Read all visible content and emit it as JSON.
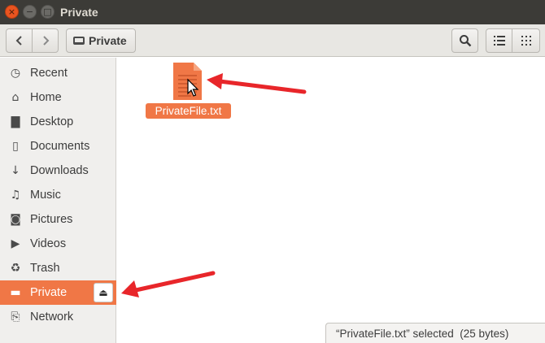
{
  "window": {
    "title": "Private",
    "close_glyph": "×",
    "minimize_glyph": "−",
    "maximize_glyph": "□"
  },
  "toolbar": {
    "back_glyph": "‹",
    "forward_glyph": "›",
    "breadcrumb_label": "Private",
    "breadcrumb_icon": "drive-icon",
    "search_icon": "search-icon",
    "list_view_icon": "list-view-icon",
    "grid_view_icon": "grid-view-icon"
  },
  "sidebar": {
    "items": [
      {
        "label": "Recent",
        "icon": "recent-icon",
        "glyph": "◷"
      },
      {
        "label": "Home",
        "icon": "home-icon",
        "glyph": "⌂"
      },
      {
        "label": "Desktop",
        "icon": "desktop-icon",
        "glyph": "▇"
      },
      {
        "label": "Documents",
        "icon": "documents-icon",
        "glyph": "▯"
      },
      {
        "label": "Downloads",
        "icon": "downloads-icon",
        "glyph": "↓"
      },
      {
        "label": "Music",
        "icon": "music-icon",
        "glyph": "♫"
      },
      {
        "label": "Pictures",
        "icon": "pictures-icon",
        "glyph": "◙"
      },
      {
        "label": "Videos",
        "icon": "videos-icon",
        "glyph": "▶"
      },
      {
        "label": "Trash",
        "icon": "trash-icon",
        "glyph": "♻"
      },
      {
        "label": "Private",
        "icon": "drive-icon",
        "glyph": "▬",
        "active": true,
        "eject_glyph": "⏏"
      },
      {
        "label": "Network",
        "icon": "network-icon",
        "glyph": "⎘"
      }
    ]
  },
  "main": {
    "file": {
      "name": "PrivateFile.txt",
      "icon": "text-file-icon",
      "selected": true
    }
  },
  "status": {
    "text": "“PrivateFile.txt” selected  (25 bytes)"
  },
  "colors": {
    "accent": "#f07746",
    "titlebar": "#3c3b37",
    "annotation_arrow": "#e8262a"
  }
}
